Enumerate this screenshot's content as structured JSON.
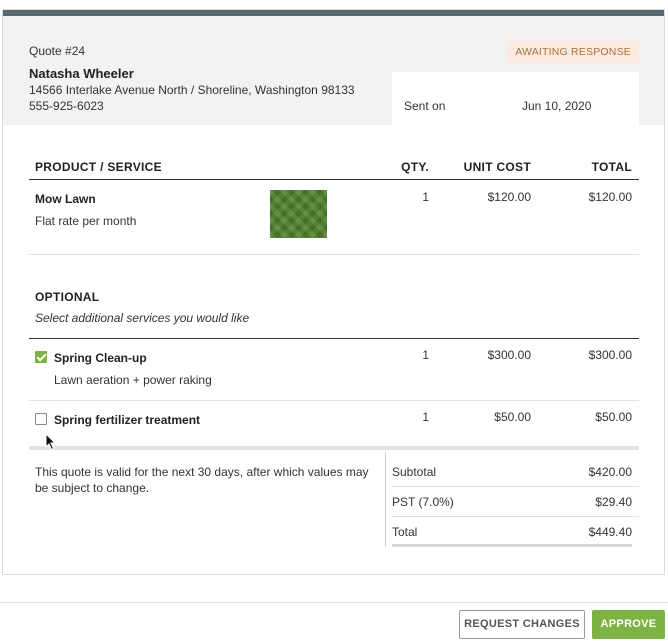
{
  "quote": {
    "number": "Quote #24",
    "status": "AWAITING RESPONSE",
    "client": {
      "name": "Natasha Wheeler",
      "address": "14566 Interlake Avenue North / Shoreline, Washington 98133",
      "phone": "555-925-6023"
    },
    "sent": {
      "label": "Sent on",
      "date": "Jun 10, 2020"
    }
  },
  "table": {
    "headers": {
      "product": "PRODUCT / SERVICE",
      "qty": "QTY.",
      "unit_cost": "UNIT COST",
      "total": "TOTAL"
    },
    "items": [
      {
        "name": "Mow Lawn",
        "description": "Flat rate per month",
        "qty": "1",
        "unit_cost": "$120.00",
        "total": "$120.00",
        "image": "lawn-photo"
      }
    ]
  },
  "optional": {
    "title": "OPTIONAL",
    "subtitle": "Select additional services you would like",
    "items": [
      {
        "name": "Spring Clean-up",
        "description": "Lawn aeration + power raking",
        "qty": "1",
        "unit_cost": "$300.00",
        "total": "$300.00",
        "checked": true
      },
      {
        "name": "Spring fertilizer treatment",
        "description": "",
        "qty": "1",
        "unit_cost": "$50.00",
        "total": "$50.00",
        "checked": false
      }
    ]
  },
  "terms": {
    "line1": "This quote is valid for the next 30 days, after which values may",
    "line2": "be subject to change."
  },
  "totals": {
    "subtotal_label": "Subtotal",
    "subtotal": "$420.00",
    "tax_label": "PST (7.0%)",
    "tax": "$29.40",
    "total_label": "Total",
    "total": "$449.40"
  },
  "actions": {
    "request_changes": "REQUEST CHANGES",
    "approve": "APPROVE"
  },
  "colors": {
    "top_bar": "#5a6872",
    "accent_green": "#7db342",
    "badge_bg": "#fbeadf",
    "badge_text": "#a8733d",
    "header_bg": "#f2f2f2"
  }
}
